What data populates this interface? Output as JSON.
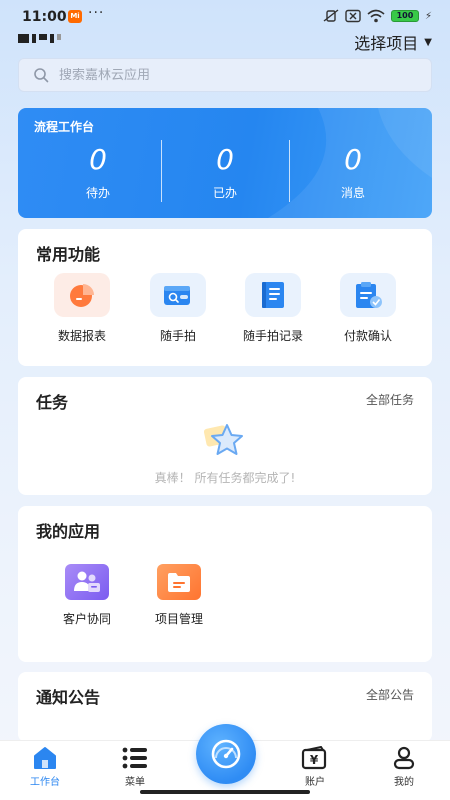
{
  "status_bar": {
    "time": "11:00",
    "mi_badge": "Mi",
    "dots": "···",
    "battery": "100"
  },
  "header": {
    "project_select_label": "选择项目"
  },
  "search": {
    "placeholder": "搜索嘉林云应用"
  },
  "workflow": {
    "title": "流程工作台",
    "stats": [
      {
        "count": "0",
        "label": "待办"
      },
      {
        "count": "0",
        "label": "已办"
      },
      {
        "count": "0",
        "label": "消息"
      }
    ]
  },
  "common_functions": {
    "title": "常用功能",
    "items": [
      {
        "label": "数据报表",
        "icon": "pie-chart-icon"
      },
      {
        "label": "随手拍",
        "icon": "wallet-search-icon"
      },
      {
        "label": "随手拍记录",
        "icon": "notebook-icon"
      },
      {
        "label": "付款确认",
        "icon": "payment-clipboard-icon"
      }
    ]
  },
  "tasks": {
    "title": "任务",
    "link": "全部任务",
    "empty_message": "真棒！ 所有任务都完成了!"
  },
  "my_apps": {
    "title": "我的应用",
    "items": [
      {
        "label": "客户协同",
        "icon": "customer-collab-icon"
      },
      {
        "label": "项目管理",
        "icon": "folder-icon"
      }
    ]
  },
  "notices": {
    "title": "通知公告",
    "link": "全部公告"
  },
  "bottom_nav": {
    "items": [
      {
        "label": "工作台",
        "icon": "home-icon",
        "active": true
      },
      {
        "label": "菜单",
        "icon": "menu-list-icon",
        "active": false
      },
      {
        "label": "账户",
        "icon": "account-yen-icon",
        "active": false
      },
      {
        "label": "我的",
        "icon": "user-icon",
        "active": false
      }
    ]
  },
  "colors": {
    "primary": "#2b86f0",
    "accent_orange": "#ff7a3d",
    "background": "#e3eefc"
  }
}
